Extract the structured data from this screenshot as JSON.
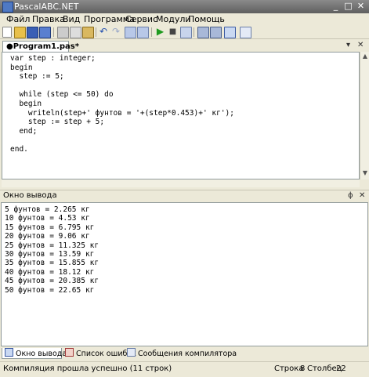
{
  "window": {
    "title": "PascalABC.NET",
    "minimize": "_",
    "maximize": "□",
    "close": "✕"
  },
  "menu": [
    "Файл",
    "Правка",
    "Вид",
    "Программа",
    "Сервис",
    "Модули",
    "Помощь"
  ],
  "editor_tab": {
    "label": "●Program1.pas*",
    "pin": "▾",
    "close": "✕"
  },
  "code_lines": [
    "var step : integer;",
    "begin",
    "  step := 5;",
    "",
    "  while (step <= 50) do",
    "  begin",
    "    writeln(step+' фунтов = '+(step*0.453)+' кг');",
    "    step := step + 5;",
    "  end;",
    "",
    "end."
  ],
  "output_panel": {
    "title": "Окно вывода",
    "pin": "ɸ",
    "close": "✕"
  },
  "output_lines": [
    "5 фунтов = 2.265 кг",
    "10 фунтов = 4.53 кг",
    "15 фунтов = 6.795 кг",
    "20 фунтов = 9.06 кг",
    "25 фунтов = 11.325 кг",
    "30 фунтов = 13.59 кг",
    "35 фунтов = 15.855 кг",
    "40 фунтов = 18.12 кг",
    "45 фунтов = 20.385 кг",
    "50 фунтов = 22.65 кг"
  ],
  "bottom_tabs": [
    "Окно вывода",
    "Список ошибок",
    "Сообщения компилятора"
  ],
  "status": {
    "message": "Компиляция прошла успешно (11 строк)",
    "row_label": "Строка",
    "row": "8",
    "col_label": "Столбец",
    "col": "22"
  }
}
